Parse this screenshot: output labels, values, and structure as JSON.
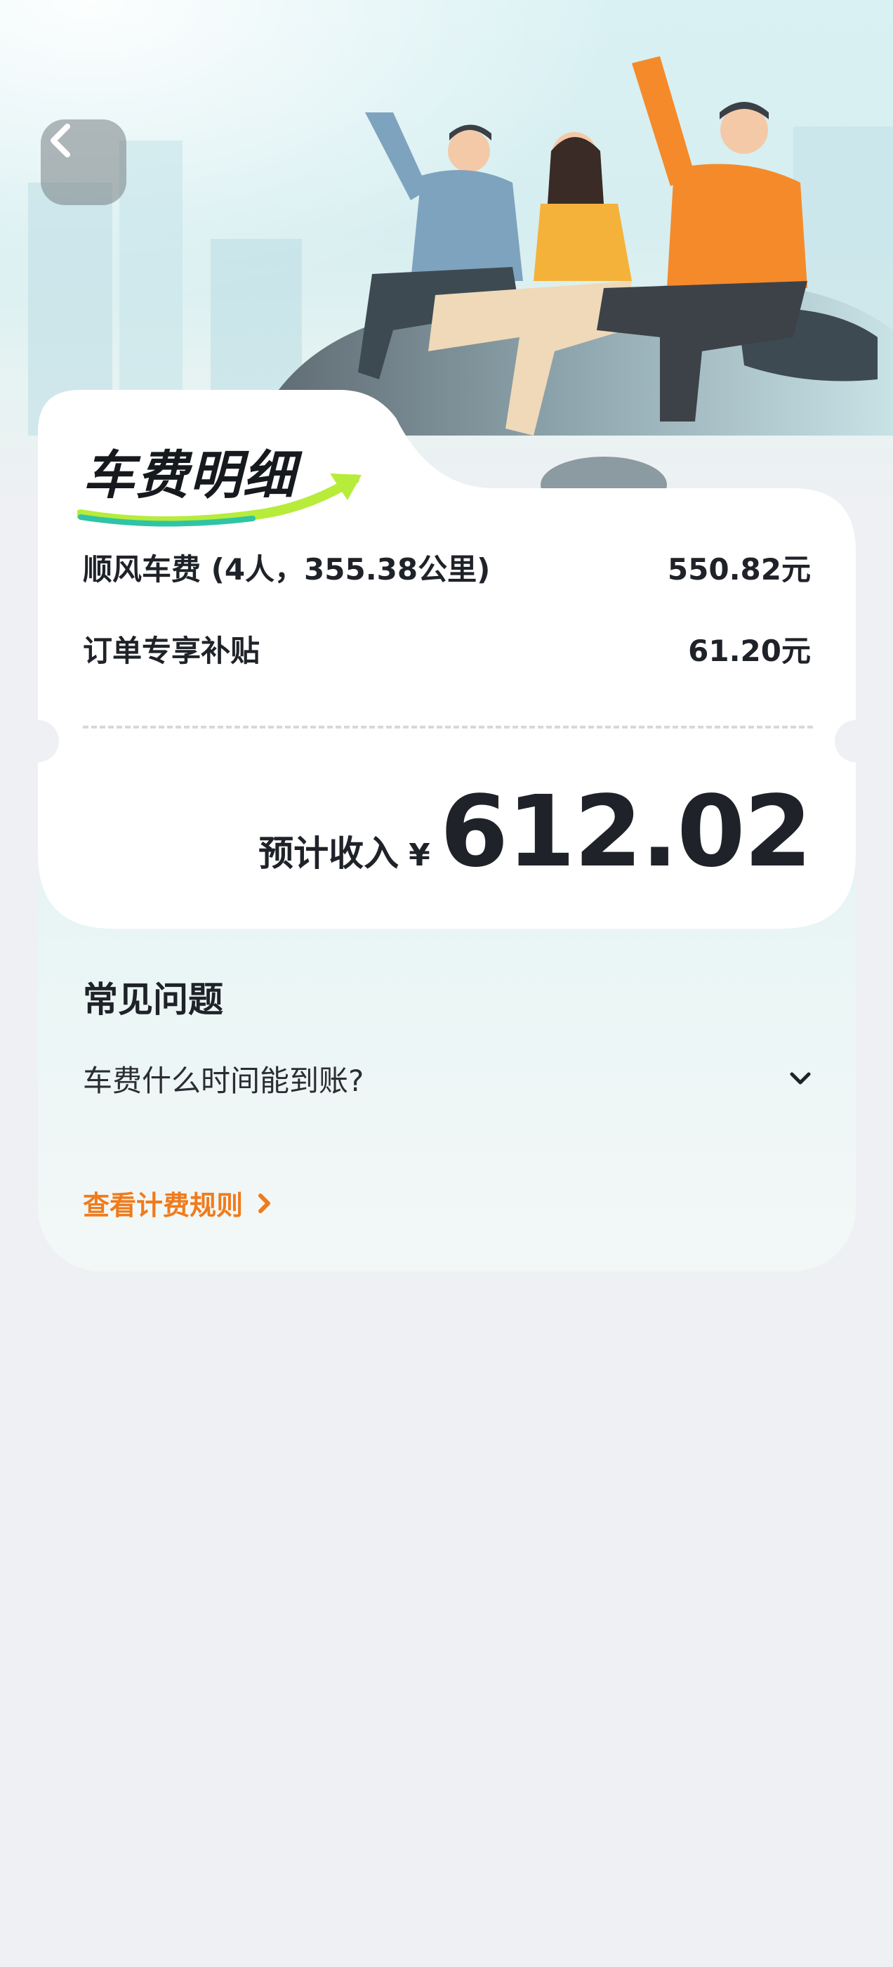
{
  "header": {
    "back_icon": "chevron-left-icon"
  },
  "card": {
    "title": "车费明细",
    "rows": [
      {
        "label": "顺风车费 (4人，355.38公里)",
        "value": "550.82元"
      },
      {
        "label": "订单专享补贴",
        "value": "61.20元"
      }
    ],
    "total_label": "预计收入",
    "total_currency": "¥",
    "total_value": "612.02"
  },
  "faq": {
    "title": "常见问题",
    "items": [
      {
        "question": "车费什么时间能到账?",
        "icon": "chevron-down-icon"
      }
    ],
    "rules_link": "查看计费规则",
    "rules_icon": "chevron-right-icon"
  },
  "colors": {
    "accent": "#f07b1c",
    "background": "#eef0f3",
    "card": "#ffffff"
  }
}
